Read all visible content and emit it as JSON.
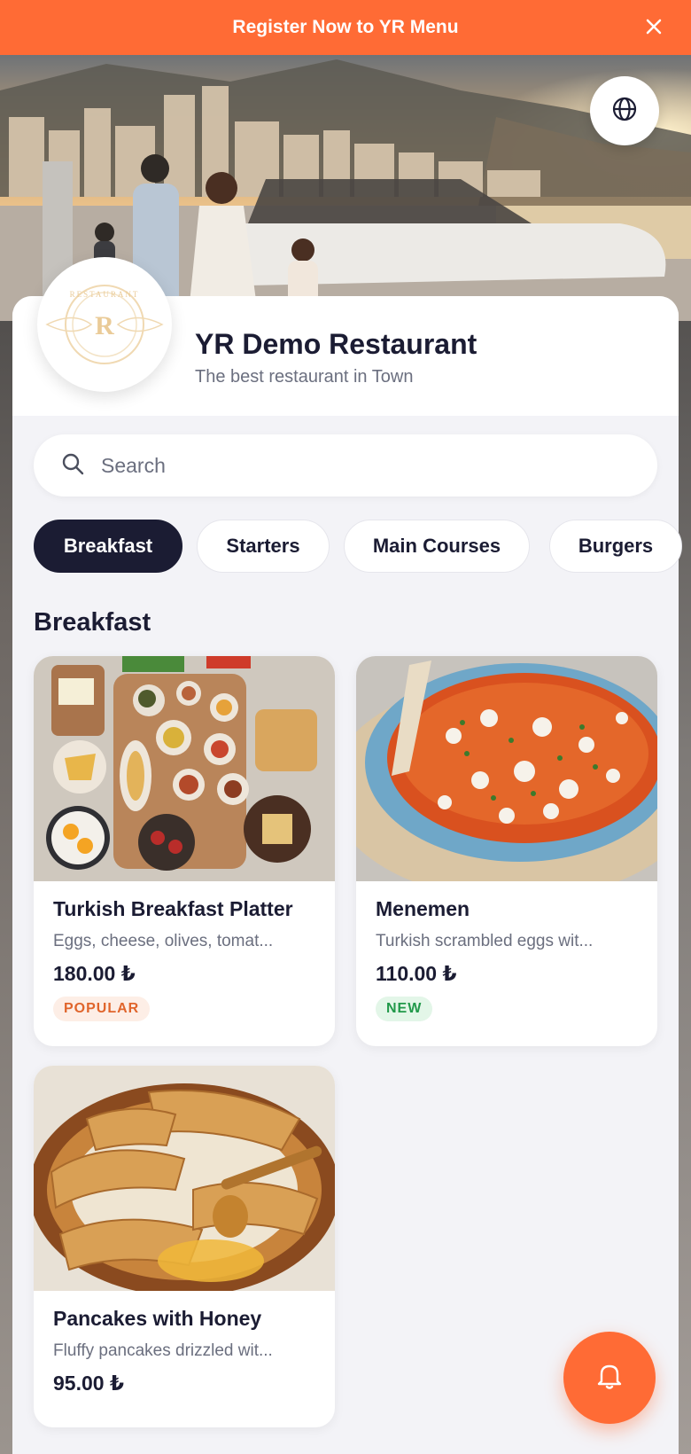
{
  "banner": {
    "text": "Register Now to YR Menu",
    "close_icon": "close-icon"
  },
  "restaurant": {
    "name": "YR Demo Restaurant",
    "tagline": "The best restaurant in Town",
    "logo_letter": "R",
    "logo_ring_text": "RESTAURANT"
  },
  "search": {
    "placeholder": "Search",
    "value": ""
  },
  "categories": [
    {
      "label": "Breakfast",
      "active": true
    },
    {
      "label": "Starters",
      "active": false
    },
    {
      "label": "Main Courses",
      "active": false
    },
    {
      "label": "Burgers",
      "active": false
    }
  ],
  "section": {
    "title": "Breakfast"
  },
  "items": [
    {
      "name": "Turkish Breakfast Platter",
      "description": "Eggs, cheese, olives, tomat...",
      "price": "180.00 ₺",
      "badge": "POPULAR"
    },
    {
      "name": "Menemen",
      "description": "Turkish scrambled eggs wit...",
      "price": "110.00 ₺",
      "badge": "NEW"
    },
    {
      "name": "Pancakes with Honey",
      "description": "Fluffy pancakes drizzled wit...",
      "price": "95.00 ₺",
      "badge": ""
    }
  ],
  "colors": {
    "accent": "#ff6b35",
    "dark": "#1b1c33",
    "muted": "#6b6f7f"
  }
}
